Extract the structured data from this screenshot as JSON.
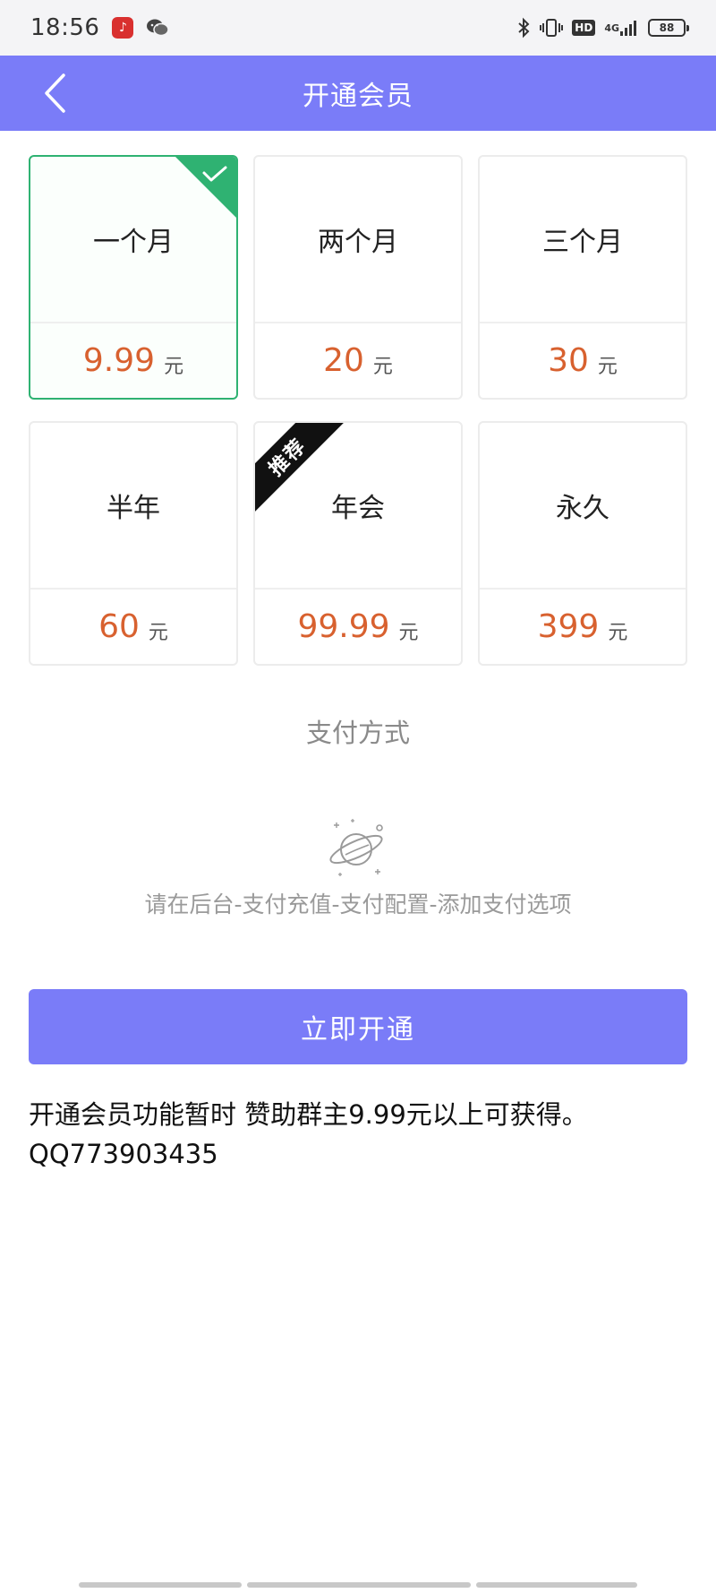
{
  "status_bar": {
    "time": "18:56",
    "app_icons": [
      "netease-music-icon",
      "wechat-icon"
    ],
    "system_icons": [
      "bluetooth-icon",
      "vibrate-icon",
      "hd-icon",
      "signal-4g-icon",
      "battery-icon"
    ],
    "hd_label": "HD",
    "network_label": "4G",
    "battery_level": "88"
  },
  "header": {
    "title": "开通会员",
    "back_icon": "chevron-left-icon",
    "background": "#7a7cf8"
  },
  "plans": [
    {
      "name": "一个月",
      "price": "9.99",
      "unit": "元",
      "selected": true
    },
    {
      "name": "两个月",
      "price": "20",
      "unit": "元",
      "selected": false
    },
    {
      "name": "三个月",
      "price": "30",
      "unit": "元",
      "selected": false
    },
    {
      "name": "半年",
      "price": "60",
      "unit": "元",
      "selected": false
    },
    {
      "name": "年会",
      "price": "99.99",
      "unit": "元",
      "selected": false,
      "ribbon": "推荐"
    },
    {
      "name": "永久",
      "price": "399",
      "unit": "元",
      "selected": false
    }
  ],
  "colors": {
    "accent": "#7a7cf8",
    "price": "#d8612f",
    "selected_border": "#2fb272"
  },
  "payment": {
    "title": "支付方式",
    "empty_icon": "planet-icon",
    "hint": "请在后台-支付充值-支付配置-添加支付选项"
  },
  "submit_label": "立即开通",
  "note": {
    "line1": "开通会员功能暂时 赞助群主9.99元以上可获得。",
    "line2": "QQ773903435"
  }
}
